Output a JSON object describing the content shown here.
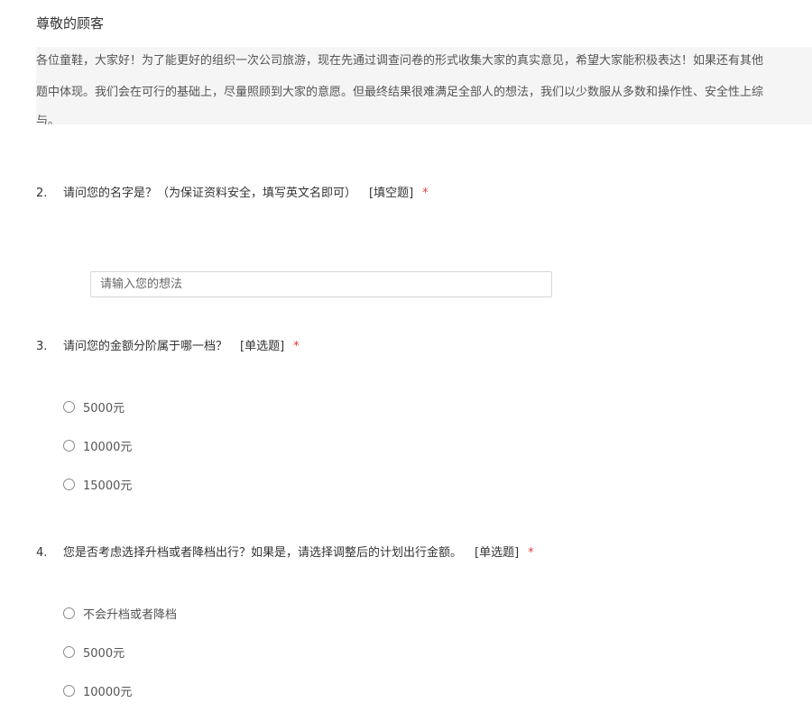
{
  "greeting": "尊敬的顾客",
  "intro": {
    "lines": [
      "各位童鞋，大家好！为了能更好的组织一次公司旅游，现在先通过调查问卷的形式收集大家的真实意见，希望大家能积极表达！如果还有其他",
      "题中体现。我们会在可行的基础上，尽量照顾到大家的意愿。但最终结果很难满足全部人的想法，我们以少数服从多数和操作性、安全性上综",
      "与。"
    ]
  },
  "questions": [
    {
      "number": "2.",
      "text": "请问您的名字是？（为保证资料安全，填写英文名即可）",
      "type": "[填空题]",
      "required": "*",
      "placeholder": "请输入您的想法"
    },
    {
      "number": "3.",
      "text": "请问您的金额分阶属于哪一档？",
      "type": "[单选题]",
      "required": "*",
      "options": [
        "5000元",
        "10000元",
        "15000元"
      ]
    },
    {
      "number": "4.",
      "text": "您是否考虑选择升档或者降档出行？如果是，请选择调整后的计划出行金额。",
      "type": "[单选题]",
      "required": "*",
      "options": [
        "不会升档或者降档",
        "5000元",
        "10000元"
      ]
    }
  ]
}
